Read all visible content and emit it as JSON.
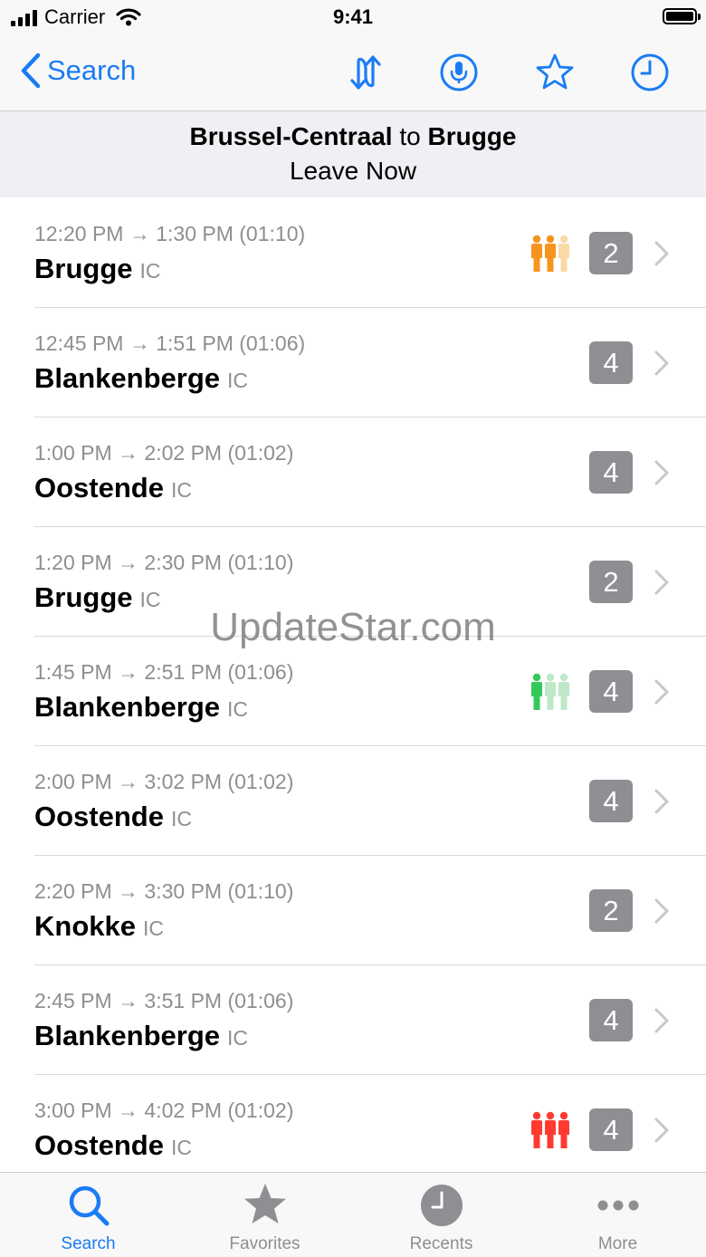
{
  "status_bar": {
    "carrier": "Carrier",
    "time": "9:41"
  },
  "nav": {
    "back_label": "Search"
  },
  "header": {
    "from": "Brussel-Centraal",
    "connector": "to",
    "to": "Brugge",
    "subtitle": "Leave Now"
  },
  "connections": [
    {
      "time": "12:20 PM → 1:30 PM (01:10)",
      "destination": "Brugge",
      "type": "IC",
      "platform": "2",
      "occupancy": {
        "level": 2,
        "color": "#f7941d",
        "light": "#fbd9a6"
      }
    },
    {
      "time": "12:45 PM → 1:51 PM (01:06)",
      "destination": "Blankenberge",
      "type": "IC",
      "platform": "4",
      "occupancy": null
    },
    {
      "time": "1:00 PM → 2:02 PM (01:02)",
      "destination": "Oostende",
      "type": "IC",
      "platform": "4",
      "occupancy": null
    },
    {
      "time": "1:20 PM → 2:30 PM (01:10)",
      "destination": "Brugge",
      "type": "IC",
      "platform": "2",
      "occupancy": null
    },
    {
      "time": "1:45 PM → 2:51 PM (01:06)",
      "destination": "Blankenberge",
      "type": "IC",
      "platform": "4",
      "occupancy": {
        "level": 1,
        "color": "#34c759",
        "light": "#bfe8c8"
      }
    },
    {
      "time": "2:00 PM → 3:02 PM (01:02)",
      "destination": "Oostende",
      "type": "IC",
      "platform": "4",
      "occupancy": null
    },
    {
      "time": "2:20 PM → 3:30 PM (01:10)",
      "destination": "Knokke",
      "type": "IC",
      "platform": "2",
      "occupancy": null
    },
    {
      "time": "2:45 PM → 3:51 PM (01:06)",
      "destination": "Blankenberge",
      "type": "IC",
      "platform": "4",
      "occupancy": null
    },
    {
      "time": "3:00 PM → 4:02 PM (01:02)",
      "destination": "Oostende",
      "type": "IC",
      "platform": "4",
      "occupancy": {
        "level": 3,
        "color": "#ff3b30",
        "light": "#ff3b30"
      }
    }
  ],
  "tabs": [
    {
      "label": "Search",
      "icon": "search-icon",
      "active": true
    },
    {
      "label": "Favorites",
      "icon": "star-icon",
      "active": false
    },
    {
      "label": "Recents",
      "icon": "clock-icon",
      "active": false
    },
    {
      "label": "More",
      "icon": "more-icon",
      "active": false
    }
  ],
  "watermark": "UpdateStar.com",
  "colors": {
    "accent": "#1a7cf5",
    "gray_text": "#8e8e93",
    "platform_bg": "#8e8e93"
  }
}
